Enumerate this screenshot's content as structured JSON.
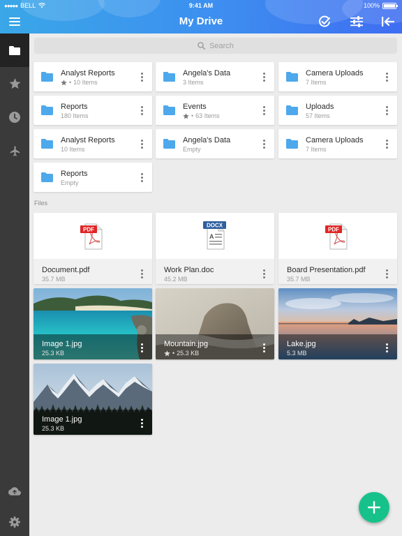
{
  "status_bar": {
    "carrier": "BELL",
    "time": "9:41 AM",
    "battery": "100%",
    "battery_level": 1.0
  },
  "header": {
    "title": "My Drive"
  },
  "search": {
    "placeholder": "Search"
  },
  "folders": [
    {
      "name": "Analyst Reports",
      "meta": "10 Items",
      "starred": true
    },
    {
      "name": "Angela's Data",
      "meta": "3 Items",
      "starred": false
    },
    {
      "name": "Camera Uploads",
      "meta": "7 Items",
      "starred": false
    },
    {
      "name": "Reports",
      "meta": "180 Items",
      "starred": false
    },
    {
      "name": "Events",
      "meta": "63 Items",
      "starred": true
    },
    {
      "name": "Uploads",
      "meta": "57 Items",
      "starred": false
    },
    {
      "name": "Analyst Reports",
      "meta": "10 Items",
      "starred": false
    },
    {
      "name": "Angela's Data",
      "meta": "Empty",
      "starred": false
    },
    {
      "name": "Camera Uploads",
      "meta": "7 Items",
      "starred": false
    },
    {
      "name": "Reports",
      "meta": "Empty",
      "starred": false
    }
  ],
  "files_section": {
    "label": "Files"
  },
  "documents": [
    {
      "name": "Document.pdf",
      "size": "35.7 MB",
      "badge": "PDF",
      "type": "pdf"
    },
    {
      "name": "Work Plan.doc",
      "size": "45.2 MB",
      "badge": "DOCX",
      "type": "docx"
    },
    {
      "name": "Board Presentation.pdf",
      "size": "35.7 MB",
      "badge": "PDF",
      "type": "pdf"
    }
  ],
  "images": [
    {
      "name": "Image 1.jpg",
      "size": "25.3 KB",
      "starred": false,
      "scene": "beach"
    },
    {
      "name": "Mountain.jpg",
      "size": "25.3 KB",
      "starred": true,
      "scene": "mountain"
    },
    {
      "name": "Lake.jpg",
      "size": "5.3 MB",
      "starred": false,
      "scene": "lake"
    },
    {
      "name": "Image 1.jpg",
      "size": "25.3 KB",
      "starred": false,
      "scene": "alps"
    }
  ],
  "colors": {
    "accent": "#3d8ef0",
    "folder": "#4ea8ec",
    "pdf": "#e02525",
    "docx": "#2f5f9e",
    "fab": "#17c28a",
    "sidebar": "#3a3a3a"
  },
  "sidebar": {
    "items": [
      {
        "icon": "folder-icon",
        "active": true
      },
      {
        "icon": "star-icon",
        "active": false
      },
      {
        "icon": "clock-icon",
        "active": false
      },
      {
        "icon": "airplane-icon",
        "active": false
      },
      {
        "icon": "cloud-upload-icon",
        "active": false
      },
      {
        "icon": "gear-icon",
        "active": false
      }
    ]
  }
}
